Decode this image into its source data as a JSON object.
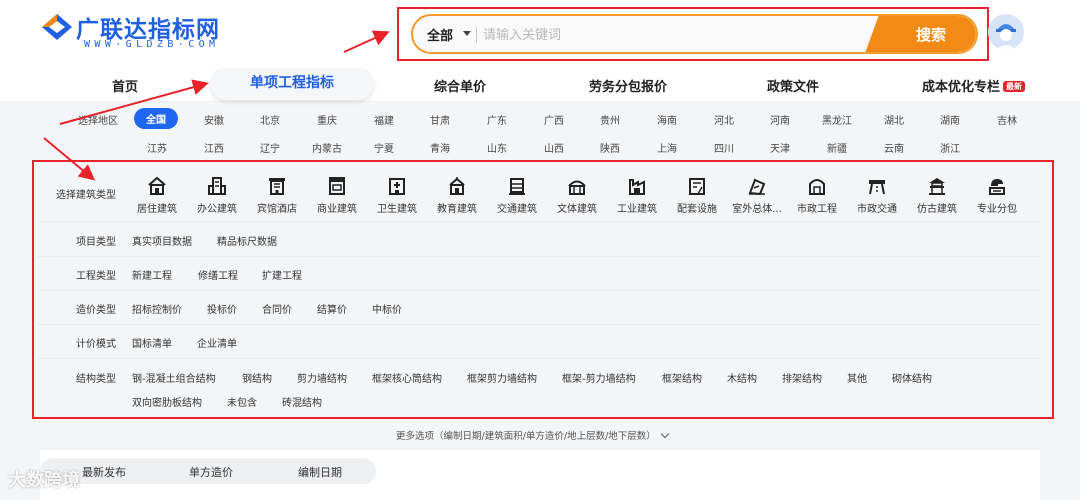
{
  "brand": {
    "name": "广联达指标网",
    "domain_text": "WWW·GLDZB·COM"
  },
  "search": {
    "scope": "全部",
    "placeholder": "请输入关键词",
    "button": "搜索"
  },
  "nav": {
    "items": [
      {
        "label": "首页"
      },
      {
        "label": "单项工程指标"
      },
      {
        "label": "综合单价"
      },
      {
        "label": "劳务分包报价"
      },
      {
        "label": "政策文件"
      },
      {
        "label": "成本优化专栏"
      }
    ],
    "badge": "最新"
  },
  "region": {
    "label": "选择地区",
    "items": [
      "全国",
      "安徽",
      "北京",
      "重庆",
      "福建",
      "甘肃",
      "广东",
      "广西",
      "贵州",
      "海南",
      "河北",
      "河南",
      "黑龙江",
      "湖北",
      "湖南",
      "吉林",
      "江苏",
      "江西",
      "辽宁",
      "内蒙古",
      "宁夏",
      "青海",
      "山东",
      "山西",
      "陕西",
      "上海",
      "四川",
      "天津",
      "新疆",
      "云南",
      "浙江"
    ],
    "selected": "全国"
  },
  "building_type": {
    "label": "选择建筑类型",
    "items": [
      {
        "label": "居住建筑",
        "icon": "house-icon"
      },
      {
        "label": "办公建筑",
        "icon": "office-icon"
      },
      {
        "label": "宾馆酒店",
        "icon": "hotel-icon"
      },
      {
        "label": "商业建筑",
        "icon": "commercial-icon"
      },
      {
        "label": "卫生建筑",
        "icon": "hospital-icon"
      },
      {
        "label": "教育建筑",
        "icon": "school-icon"
      },
      {
        "label": "交通建筑",
        "icon": "transport-icon"
      },
      {
        "label": "文体建筑",
        "icon": "stadium-icon"
      },
      {
        "label": "工业建筑",
        "icon": "factory-icon"
      },
      {
        "label": "配套设施",
        "icon": "facility-icon"
      },
      {
        "label": "室外总体...",
        "icon": "outdoor-icon"
      },
      {
        "label": "市政工程",
        "icon": "municipal-icon"
      },
      {
        "label": "市政交通",
        "icon": "road-icon"
      },
      {
        "label": "仿古建筑",
        "icon": "pagoda-icon"
      },
      {
        "label": "专业分包",
        "icon": "subcontract-icon"
      }
    ]
  },
  "filters": [
    {
      "label": "项目类型",
      "options": [
        "真实项目数据",
        "精品标尺数据"
      ]
    },
    {
      "label": "工程类型",
      "options": [
        "新建工程",
        "修缮工程",
        "扩建工程"
      ]
    },
    {
      "label": "造价类型",
      "options": [
        "招标控制价",
        "投标价",
        "合同价",
        "结算价",
        "中标价"
      ]
    },
    {
      "label": "计价模式",
      "options": [
        "国标清单",
        "企业清单"
      ]
    },
    {
      "label": "结构类型",
      "options": [
        "钢-混凝土组合结构",
        "钢结构",
        "剪力墙结构",
        "框架核心筒结构",
        "框架剪力墙结构",
        "框架-剪力墙结构",
        "框架结构",
        "木结构",
        "排架结构",
        "其他",
        "砌体结构",
        "双向密肋板结构",
        "未包含",
        "砖混结构"
      ]
    }
  ],
  "more_options": "更多选项（编制日期/建筑面积/单方造价/地上层数/地下层数）",
  "sort_tabs": [
    "最新发布",
    "单方造价",
    "编制日期"
  ],
  "watermark": "大数跨境",
  "colors": {
    "brand_blue": "#1f5fe0",
    "search_orange": "#f28b16",
    "annotation_red": "#e8212a",
    "chip_blue": "#1f66f0"
  }
}
